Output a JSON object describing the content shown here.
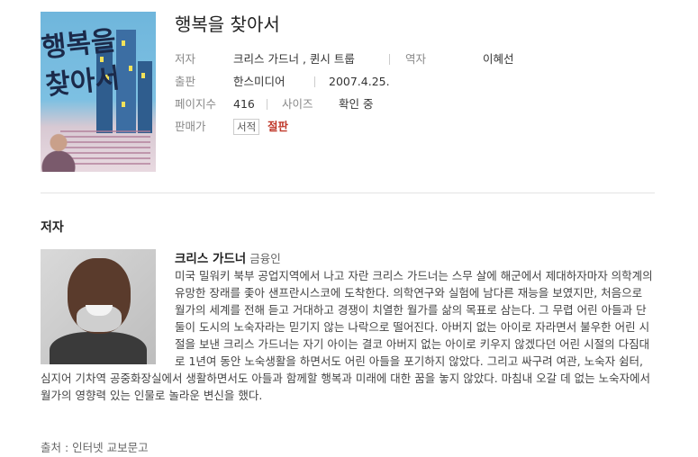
{
  "book": {
    "title": "행복을 찾아서",
    "cover_title_lines": [
      "행복을",
      "찾아서"
    ],
    "author_label": "저자",
    "authors": "크리스 가드너 ,  퀸시 트룹",
    "translator_label": "역자",
    "translator": "이혜선",
    "publish_label": "출판",
    "publisher": "한스미디어",
    "publish_date": "2007.4.25.",
    "pages_label": "페이지수",
    "pages": "416",
    "size_label": "사이즈",
    "size": "확인 중",
    "seller_label": "판매가",
    "seller_badge": "서적",
    "seller_status": "절판"
  },
  "author_section": {
    "heading": "저자",
    "name": "크리스 가드너",
    "name_suffix": "금융인",
    "bio": "미국 밀워키 북부 공업지역에서 나고 자란 크리스 가드너는 스무 살에 해군에서 제대하자마자 의학계의 유망한 장래를 좇아 샌프란시스코에 도착한다. 의학연구와 실험에 남다른 재능을 보였지만, 처음으로 월가의 세계를 전해 듣고 거대하고 경쟁이 치열한 월가를 삶의 목표로 삼는다. 그 무렵 어린 아들과 단둘이 도시의 노숙자라는 믿기지 않는 나락으로 떨어진다. 아버지 없는 아이로 자라면서 불우한 어린 시절을 보낸 크리스 가드너는 자기 아이는 결코 아버지 없는 아이로 키우지 않겠다던 어린 시절의 다짐대로 1년여 동안 노숙생활을 하면서도 어린 아들을 포기하지 않았다. 그리고 싸구려 여관, 노숙자 쉼터, 심지어 기차역 공중화장실에서 생활하면서도 아들과 함께할 행복과 미래에 대한 꿈을 놓지 않았다. 마침내 오갈 데 없는 노숙자에서 월가의 영향력 있는 인물로 놀라운 변신을 했다.",
    "source": "출처 :  인터넷 교보문고"
  },
  "colors": {
    "out_of_print": "#c0392b",
    "label_gray": "#888888",
    "divider": "#e3e3e3"
  }
}
